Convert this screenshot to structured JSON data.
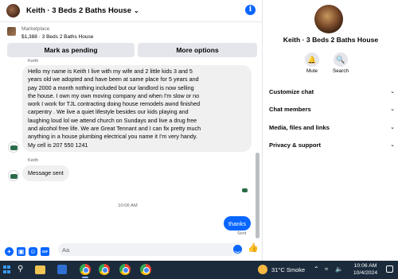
{
  "chat": {
    "title": "Keith · 3 Beds 2 Baths House",
    "marketplace_label": "Marketplace",
    "listing_summary": "$1,388 · 3 Beds 2 Baths House",
    "mark_pending_label": "Mark as pending",
    "more_options_label": "More options",
    "messages": [
      {
        "sender": "Keith",
        "lines": [
          "Hello my name is Keith I live with my wife and 2 little kids 3 and 5",
          "years old we adopted and have been at same place for 5 years and",
          "pay 2000 a month nothing included but our landlord is now selling",
          "the house. I own my own moving company and when I'm slow or no",
          "work I work for TJL contracting doing house remodels awnd finished",
          "carpentry .  We live a quiet lifestyle besides our kids playing and",
          "laughing loud lol we attend church on Sundays  and live a drug free",
          "and alcohol free life.  We are Great Tennant and I can fix pretty much",
          "anything in a house plumbing electrical you name it I'm very handy.",
          "My cell is 207 550 1241"
        ]
      },
      {
        "sender": "Keith",
        "text": "Message sent"
      }
    ],
    "time_divider": "10:06 AM",
    "outgoing": {
      "text": "thanks",
      "status": "Sent"
    },
    "composer_placeholder": "Aa",
    "like_icon": "thumbs-up-icon",
    "accent_color": "#0866ff"
  },
  "details": {
    "name": "Keith · 3 Beds 2 Baths House",
    "mute_label": "Mute",
    "search_label": "Search",
    "sections": [
      "Customize chat",
      "Chat members",
      "Media, files and links",
      "Privacy & support"
    ]
  },
  "taskbar": {
    "weather": "31°C  Smoke",
    "time": "10:06 AM",
    "date": "10/4/2024"
  }
}
